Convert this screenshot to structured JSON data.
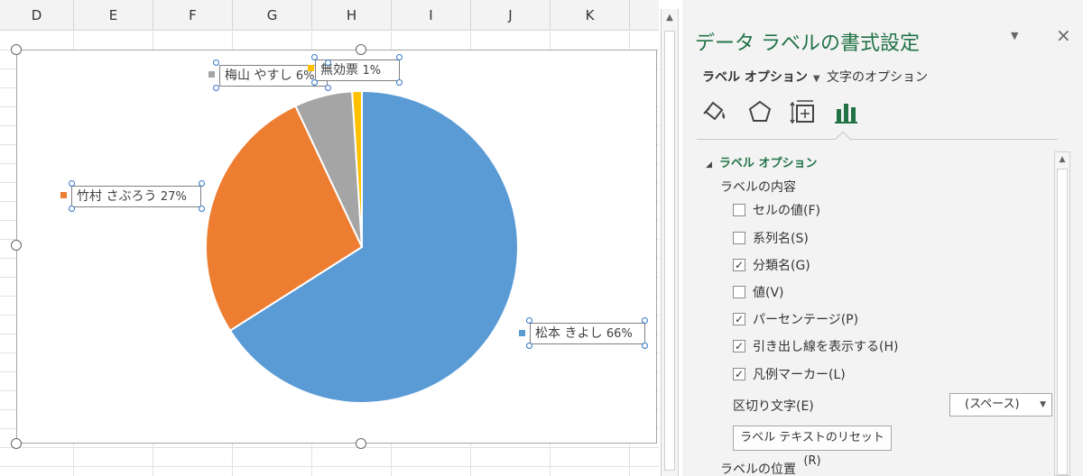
{
  "sheet": {
    "columns": [
      "D",
      "E",
      "F",
      "G",
      "H",
      "I",
      "J",
      "K"
    ]
  },
  "chart_data": {
    "type": "pie",
    "categories": [
      "松本 きよし",
      "竹村 さぶろう",
      "梅山 やすし",
      "無効票"
    ],
    "values": [
      66,
      27,
      6,
      1
    ],
    "colors": [
      "#5b9bd5",
      "#ed7d31",
      "#a5a5a5",
      "#ffc000"
    ],
    "labels": [
      {
        "name": "松本 きよし",
        "pct": "66%"
      },
      {
        "name": "竹村 さぶろう",
        "pct": "27%"
      },
      {
        "name": "梅山 やすし",
        "pct": "6%"
      },
      {
        "name": "無効票",
        "pct": "1%"
      }
    ]
  },
  "pane": {
    "title": "データ ラベルの書式設定",
    "tabs": {
      "label_options": "ラベル オプション",
      "text_options": "文字のオプション"
    },
    "section_title": "ラベル オプション",
    "contents_label": "ラベルの内容",
    "options": [
      {
        "label": "セルの値(F)",
        "checked": false
      },
      {
        "label": "系列名(S)",
        "checked": false
      },
      {
        "label": "分類名(G)",
        "checked": true
      },
      {
        "label": "値(V)",
        "checked": false
      },
      {
        "label": "パーセンテージ(P)",
        "checked": true
      },
      {
        "label": "引き出し線を表示する(H)",
        "checked": true
      },
      {
        "label": "凡例マーカー(L)",
        "checked": true
      }
    ],
    "separator_label": "区切り文字(E)",
    "separator_value": "(スペース)",
    "reset_button": "ラベル テキストのリセット(R)",
    "position_label": "ラベルの位置",
    "close_symbol": "×",
    "dropdown_symbol": "▼",
    "icons": [
      "fill-line-icon",
      "effects-pentagon-icon",
      "size-properties-icon",
      "label-options-bar-chart-icon"
    ],
    "accent_color": "#217346"
  }
}
